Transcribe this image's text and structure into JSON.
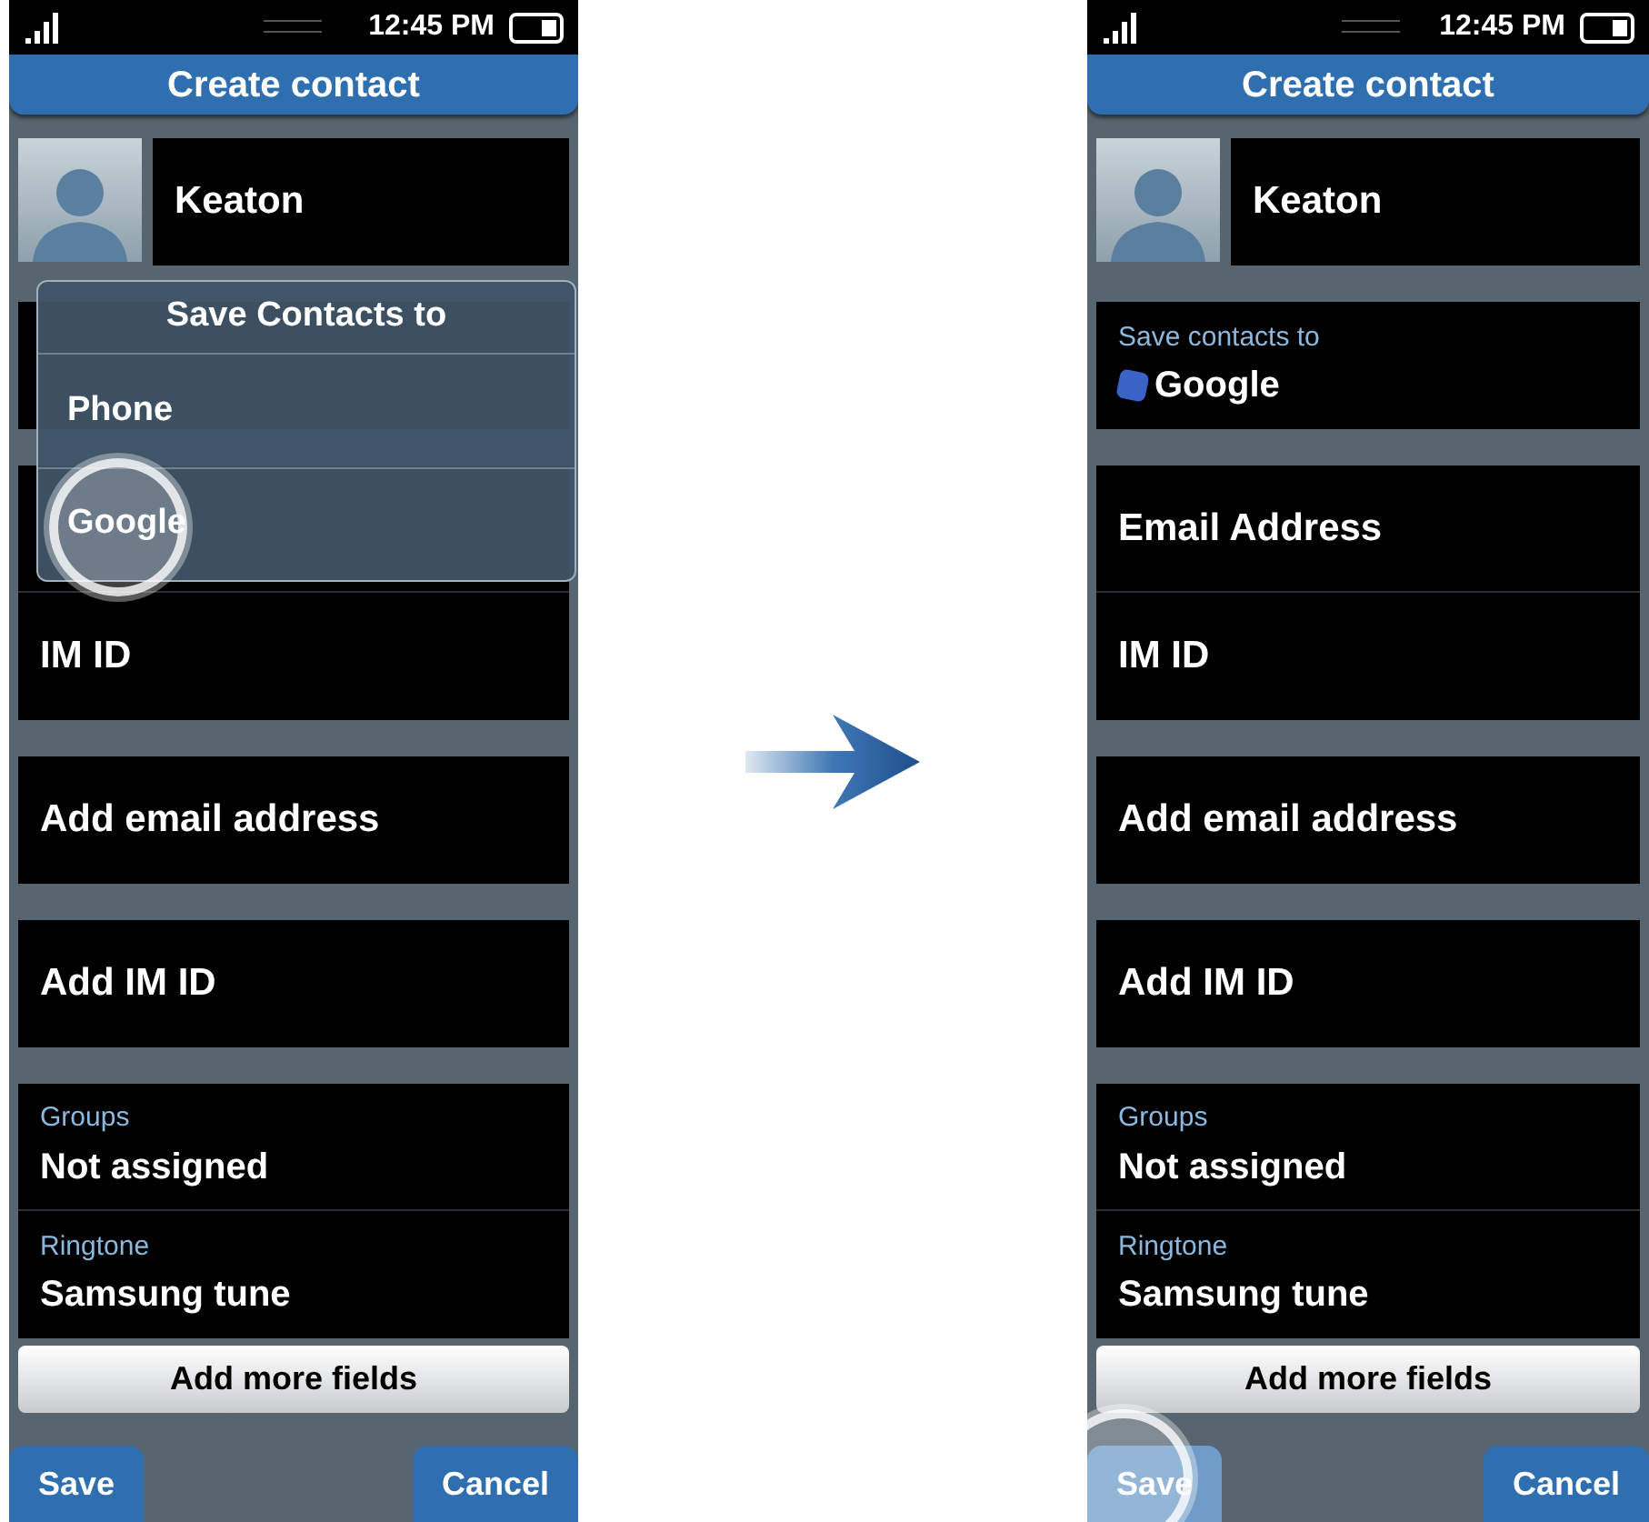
{
  "screens": [
    {
      "status_bar": {
        "time": "12:45 PM"
      },
      "title": "Create contact",
      "contact_name": "Keaton",
      "groups": [
        {
          "items": [
            {
              "kind": "hidden"
            }
          ]
        },
        {
          "items": [
            {
              "kind": "hidden"
            },
            {
              "kind": "entry",
              "text": "IM ID"
            }
          ]
        },
        {
          "items": [
            {
              "kind": "entry",
              "text": "Add email address"
            }
          ]
        },
        {
          "items": [
            {
              "kind": "entry",
              "text": "Add IM ID"
            }
          ]
        },
        {
          "items": [
            {
              "kind": "setting",
              "label": "Groups",
              "value": "Not assigned"
            },
            {
              "kind": "setting",
              "label": "Ringtone",
              "value": "Samsung tune"
            }
          ]
        }
      ],
      "add_more": "Add more fields",
      "buttons": [
        {
          "label": "Save",
          "tapped": false
        },
        {
          "label": "Cancel",
          "tapped": false
        }
      ],
      "dialog": {
        "title": "Save Contacts to",
        "options": [
          {
            "label": "Phone",
            "tapped": false
          },
          {
            "label": "Google",
            "tapped": true
          }
        ]
      }
    },
    {
      "status_bar": {
        "time": "12:45 PM"
      },
      "title": "Create contact",
      "contact_name": "Keaton",
      "groups": [
        {
          "items": [
            {
              "kind": "account",
              "label": "Save contacts to",
              "value": "Google"
            }
          ]
        },
        {
          "items": [
            {
              "kind": "entry",
              "text": "Email Address"
            },
            {
              "kind": "entry",
              "text": "IM ID"
            }
          ]
        },
        {
          "items": [
            {
              "kind": "entry",
              "text": "Add email address"
            }
          ]
        },
        {
          "items": [
            {
              "kind": "entry",
              "text": "Add IM ID"
            }
          ]
        },
        {
          "items": [
            {
              "kind": "setting",
              "label": "Groups",
              "value": "Not assigned"
            },
            {
              "kind": "setting",
              "label": "Ringtone",
              "value": "Samsung tune"
            }
          ]
        }
      ],
      "add_more": "Add more fields",
      "buttons": [
        {
          "label": "Save",
          "tapped": true
        },
        {
          "label": "Cancel",
          "tapped": false
        }
      ]
    }
  ]
}
